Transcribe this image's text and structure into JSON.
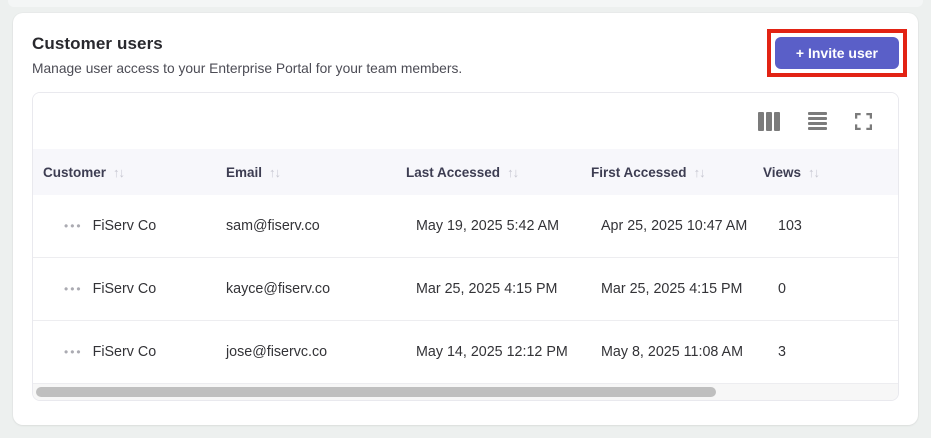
{
  "header": {
    "title": "Customer users",
    "subtitle": "Manage user access to your Enterprise Portal for your team members.",
    "invite_button_label": "+ Invite user"
  },
  "table": {
    "columns": [
      {
        "label": "Customer"
      },
      {
        "label": "Email"
      },
      {
        "label": "Last Accessed"
      },
      {
        "label": "First Accessed"
      },
      {
        "label": "Views"
      }
    ],
    "sort_icon": "↑↓",
    "row_menu_icon": "•••",
    "rows": [
      {
        "customer": "FiServ Co",
        "email": "sam@fiserv.co",
        "last_accessed": "May 19, 2025 5:42 AM",
        "first_accessed": "Apr 25, 2025 10:47 AM",
        "views": "103"
      },
      {
        "customer": "FiServ Co",
        "email": "kayce@fiserv.co",
        "last_accessed": "Mar 25, 2025 4:15 PM",
        "first_accessed": "Mar 25, 2025 4:15 PM",
        "views": "0"
      },
      {
        "customer": "FiServ Co",
        "email": "jose@fiservc.co",
        "last_accessed": "May 14, 2025 12:12 PM",
        "first_accessed": "May 8, 2025 11:08 AM",
        "views": "3"
      }
    ]
  },
  "colors": {
    "accent": "#5a5fc8",
    "annotation_highlight": "#e22314",
    "header_row_bg": "#f7f7fb",
    "page_bg": "#edf0ef"
  }
}
